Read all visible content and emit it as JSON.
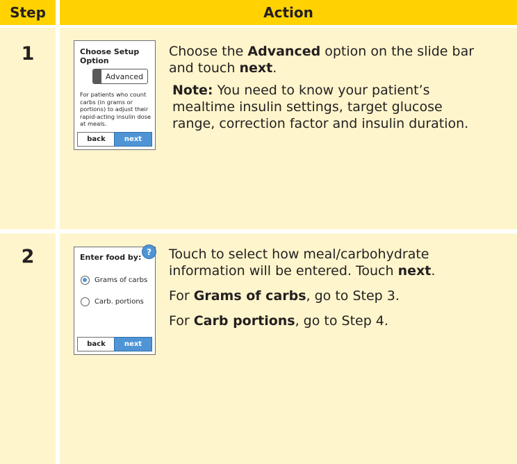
{
  "header": {
    "step": "Step",
    "action": "Action"
  },
  "rows": [
    {
      "number": "1",
      "screen": {
        "title": "Choose Setup Option",
        "slider_label": "Advanced",
        "description": "For patients who count carbs (in grams or portions) to adjust their rapid-acting insulin dose at meals.",
        "back": "back",
        "next": "next"
      },
      "line1_a": "Choose the ",
      "line1_b": "Advanced",
      "line1_c": " option on the slide bar",
      "line2_a": "and touch ",
      "line2_b": "next",
      "line2_c": ".",
      "note_label": "Note:",
      "note_text1": " You need to know your patient’s",
      "note_text2": "mealtime insulin settings, target glucose",
      "note_text3": "range, correction factor and insulin duration."
    },
    {
      "number": "2",
      "screen": {
        "title": "Enter food by:",
        "help": "?",
        "option1": "Grams of carbs",
        "option2": "Carb. portions",
        "back": "back",
        "next": "next"
      },
      "line1": "Touch to select how meal/carbohydrate",
      "line2_a": "information will be entered. Touch ",
      "line2_b": "next",
      "line2_c": ".",
      "line3_a": "For ",
      "line3_b": "Grams of carbs",
      "line3_c": ", go to Step 3.",
      "line4_a": "For ",
      "line4_b": "Carb portions",
      "line4_c": ", go to Step 4."
    }
  ],
  "colors": {
    "header_bg": "#ffd200",
    "cell_bg": "#fef5cc",
    "button_blue": "#4f95d6"
  }
}
